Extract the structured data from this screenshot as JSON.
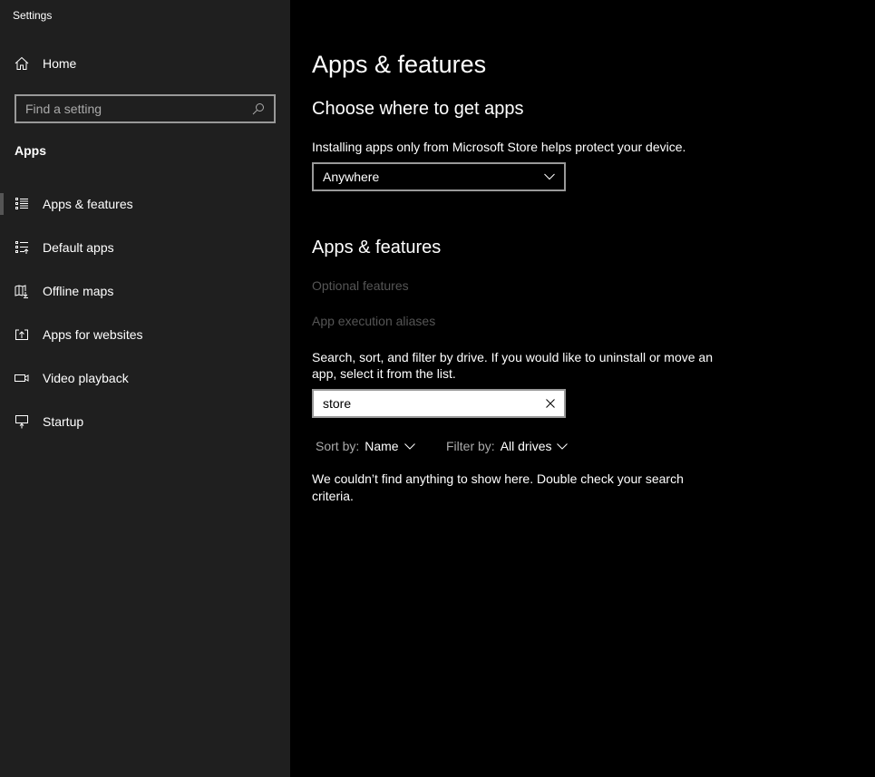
{
  "window_title": "Settings",
  "sidebar": {
    "home": "Home",
    "search_placeholder": "Find a setting",
    "section": "Apps",
    "items": [
      {
        "label": "Apps & features",
        "icon": "list-icon",
        "selected": true
      },
      {
        "label": "Default apps",
        "icon": "default-apps-icon"
      },
      {
        "label": "Offline maps",
        "icon": "map-download-icon"
      },
      {
        "label": "Apps for websites",
        "icon": "open-in-app-icon"
      },
      {
        "label": "Video playback",
        "icon": "video-icon"
      },
      {
        "label": "Startup",
        "icon": "startup-icon"
      }
    ]
  },
  "main": {
    "title": "Apps & features",
    "choose_heading": "Choose where to get apps",
    "choose_desc": "Installing apps only from Microsoft Store helps protect your device.",
    "source_value": "Anywhere",
    "features_heading": "Apps & features",
    "optional_features": "Optional features",
    "aliases": "App execution aliases",
    "search_desc_1": "Search, sort, and filter by drive. If you would like to uninstall or move an",
    "search_desc_2": "app, select it from the list.",
    "search_value": "store",
    "sort_label": "Sort by:",
    "sort_value": "Name",
    "filter_label": "Filter by:",
    "filter_value": "All drives",
    "empty_1": "We couldn’t find anything to show here. Double check your search",
    "empty_2": "criteria."
  }
}
